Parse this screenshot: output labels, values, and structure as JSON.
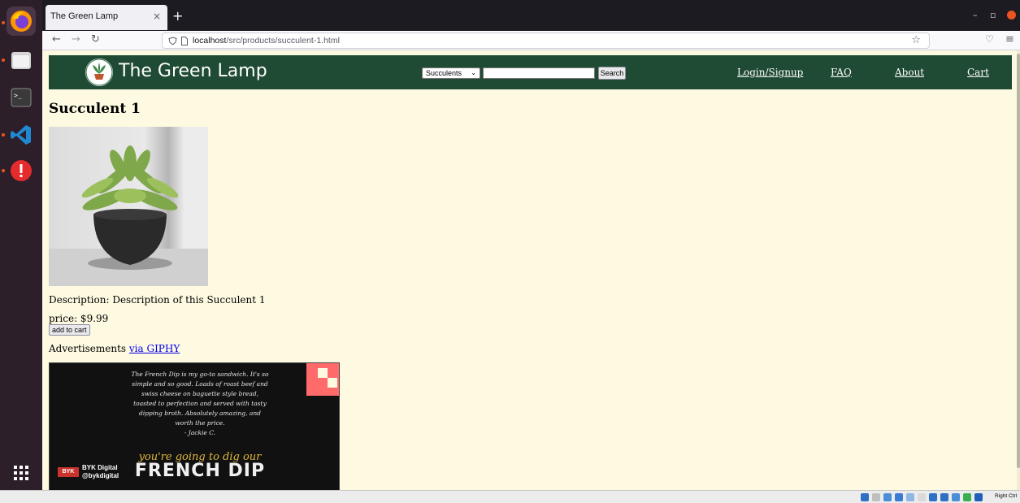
{
  "browser": {
    "tab_title": "The Green Lamp",
    "tab_close": "×",
    "new_tab": "+",
    "url_host": "localhost",
    "url_path": "/src/products/succulent-1.html"
  },
  "header": {
    "site_title": "The Green Lamp",
    "category_selected": "Succulents",
    "search_button": "Search",
    "nav": {
      "login": "Login/Signup",
      "faq": "FAQ",
      "about": "About",
      "cart": "Cart"
    }
  },
  "product": {
    "title": "Succulent 1",
    "description": "Description: Description of this Succulent 1",
    "price": "price: $9.99",
    "add_to_cart": "add to cart"
  },
  "ads": {
    "label": "Advertisements ",
    "link_text": "via GIPHY",
    "quote": "The French Dip is my go-to sandwich. It's so simple and so good. Loads of roast beef and swiss cheese on baguette style bread, toasted to perfection and served with tasty dipping broth. Absolutely amazing, and worth the price.",
    "quote_author": "- Jackie C.",
    "tagline": "you're going to dig our",
    "headline": "FRENCH DIP",
    "brand_name": "BYK Digital",
    "brand_handle": "@bykdigital",
    "brand_badge": "BYK"
  },
  "statusbar": {
    "host_key": "Right Ctrl"
  },
  "colors": {
    "header_bg": "#1f4a33",
    "page_bg": "#fef9e1",
    "link": "#0000ee",
    "ubuntu_accent": "#e95420"
  }
}
